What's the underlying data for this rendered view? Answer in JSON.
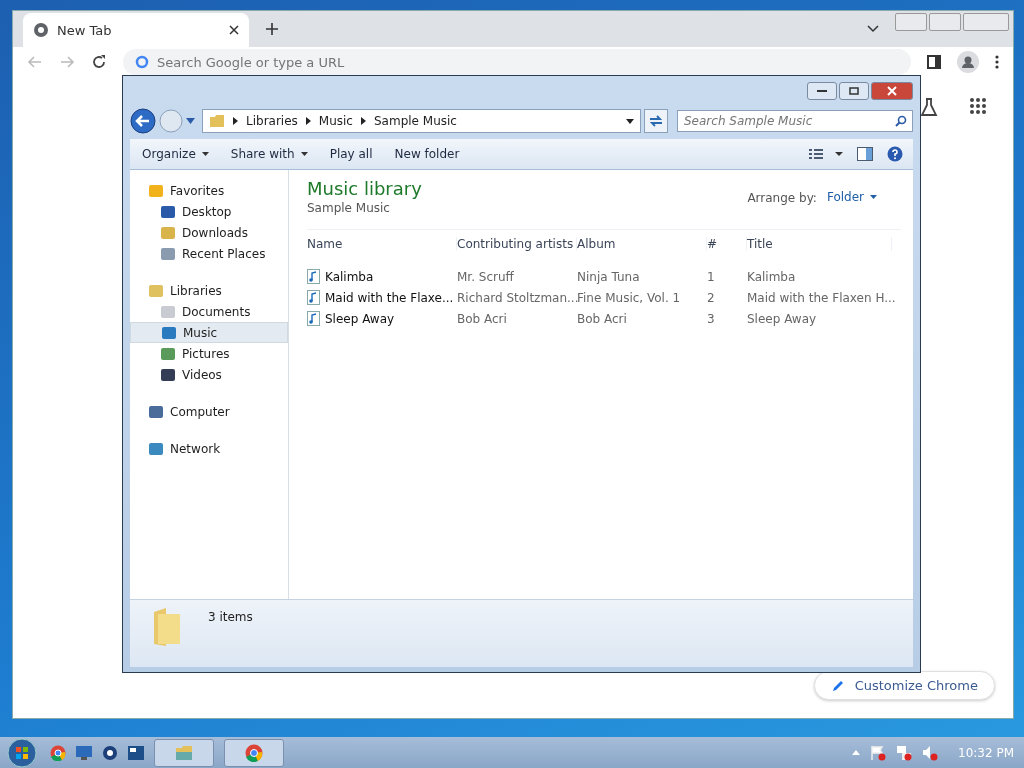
{
  "browser": {
    "tabs": [
      {
        "title": "New Tab",
        "selected": true
      }
    ],
    "address": {
      "placeholder": "Search Google or type a URL"
    },
    "customize_button": "Customize Chrome"
  },
  "explorer": {
    "breadcrumb": [
      "Libraries",
      "Music",
      "Sample Music"
    ],
    "search": {
      "placeholder": "Search Sample Music"
    },
    "commands": [
      {
        "label": "Organize",
        "dropdown": true
      },
      {
        "label": "Share with",
        "dropdown": true
      },
      {
        "label": "Play all",
        "dropdown": false
      },
      {
        "label": "New folder",
        "dropdown": false
      }
    ],
    "nav": [
      {
        "label": "Favorites",
        "selected": false,
        "children": [
          {
            "label": "Desktop",
            "selected": false
          },
          {
            "label": "Downloads",
            "selected": false
          },
          {
            "label": "Recent Places",
            "selected": false
          }
        ]
      },
      {
        "label": "Libraries",
        "selected": false,
        "children": [
          {
            "label": "Documents",
            "selected": false
          },
          {
            "label": "Music",
            "selected": true
          },
          {
            "label": "Pictures",
            "selected": false
          },
          {
            "label": "Videos",
            "selected": false
          }
        ]
      },
      {
        "label": "Computer",
        "selected": false
      },
      {
        "label": "Network",
        "selected": false
      }
    ],
    "library_title": "Music library",
    "library_subtitle": "Sample Music",
    "arrange_label": "Arrange by:",
    "arrange_value": "Folder",
    "columns": [
      "Name",
      "Contributing artists",
      "Album",
      "#",
      "Title"
    ],
    "rows": [
      [
        "Kalimba",
        "Mr. Scruff",
        "Ninja Tuna",
        "1",
        "Kalimba"
      ],
      [
        "Maid with the Flaxe...",
        "Richard Stoltzman...",
        "Fine Music, Vol. 1",
        "2",
        "Maid with the Flaxen H..."
      ],
      [
        "Sleep Away",
        "Bob Acri",
        "Bob Acri",
        "3",
        "Sleep Away"
      ]
    ],
    "status": "3 items"
  },
  "taskbar": {
    "clock": "10:32 PM"
  }
}
